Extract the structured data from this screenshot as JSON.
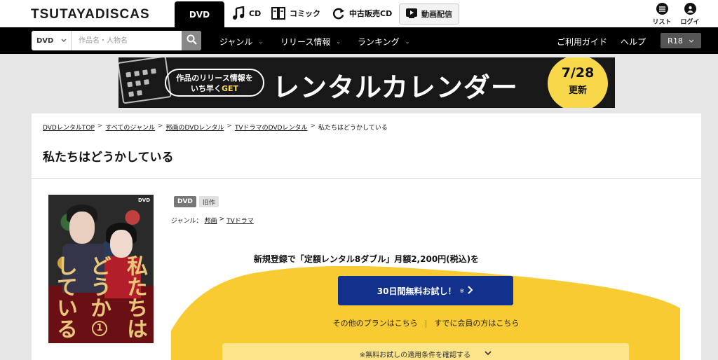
{
  "header": {
    "logo_text": "TSUTAYADISCAS",
    "nav": [
      {
        "label": "DVD",
        "icon": "dvd"
      },
      {
        "label": "CD",
        "icon": "music-note-icon"
      },
      {
        "label": "コミック",
        "icon": "book-icon"
      },
      {
        "label": "中古販売CD",
        "icon": "refresh-icon"
      }
    ],
    "stream_label": "動画配信",
    "list_label": "リスト",
    "login_label": "ログイン"
  },
  "searchbar": {
    "type_value": "DVD",
    "placeholder": "作品名・人物名",
    "menus": [
      "ジャンル",
      "リリース情報",
      "ランキング"
    ],
    "guide_label": "ご利用ガイド",
    "help_label": "ヘルプ",
    "r18_label": "R18"
  },
  "banner": {
    "pill_line1": "作品のリリース情報を",
    "pill_line2a": "いち早く",
    "pill_line2b": "GET",
    "headline": "レンタルカレンダー",
    "date": "7/28",
    "date_suffix": "更新",
    "accent_color": "#f6d84a"
  },
  "breadcrumb": [
    {
      "label": "DVDレンタルTOP",
      "link": true
    },
    {
      "label": "すべてのジャンル",
      "link": true
    },
    {
      "label": "邦画のDVDレンタル",
      "link": true
    },
    {
      "label": "TVドラマのDVDレンタル",
      "link": true
    },
    {
      "label": "私たちはどうかしている",
      "link": false
    }
  ],
  "page_title": "私たちはどうかしている",
  "product": {
    "cover_title_col1": "私たちは",
    "cover_title_col2": "どうか",
    "cover_title_col3": "している",
    "cover_volume": "1",
    "cover_dvd_mark": "DVD",
    "badges": [
      "DVD",
      "旧作"
    ],
    "genre_label": "ジャンル：",
    "genre_path": [
      "邦画",
      "TVドラマ"
    ]
  },
  "promo": {
    "text": "新規登録で「定額レンタル8ダブル」月額2,200円(税込)を",
    "cta_label": "30日間無料お試し！",
    "cta_note": "※",
    "link_other_plans": "その他のプランはこちら",
    "link_members": "すでに会員の方はこちら",
    "terms_label": "※無料お試しの適用条件を確認する",
    "cta_color": "#11318c",
    "bg_color": "#f8cb33"
  }
}
